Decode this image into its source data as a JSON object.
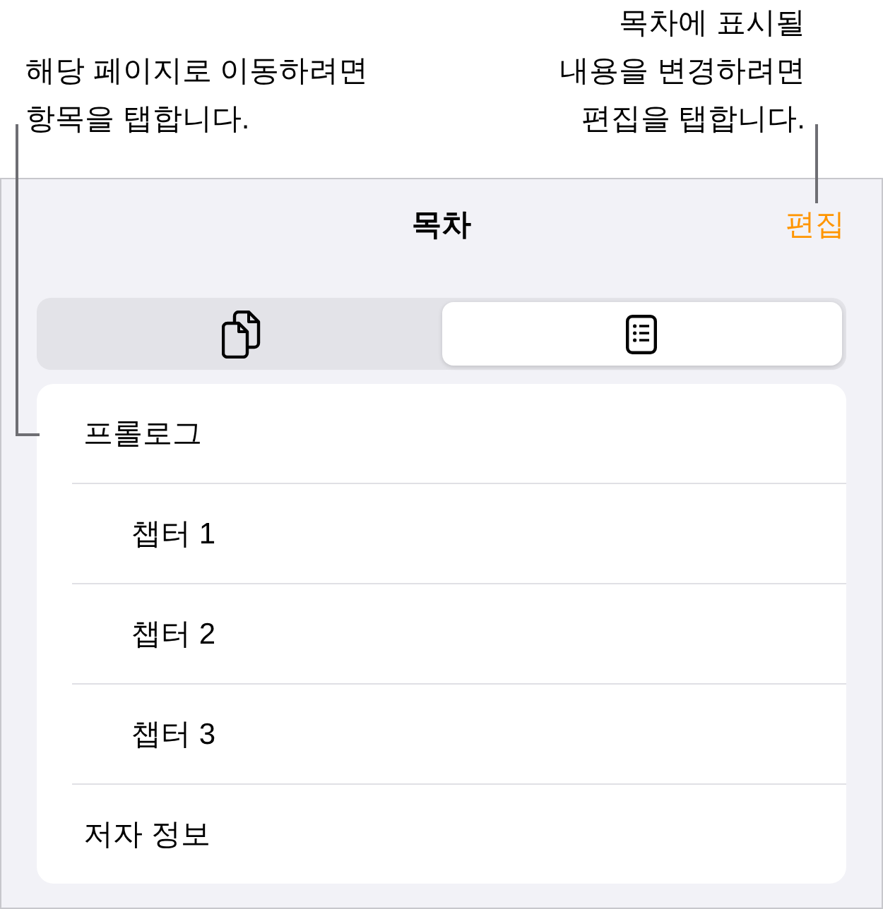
{
  "callouts": [
    {
      "kind": "left",
      "text": "해당 페이지로 이동하려면\n항목을 탭합니다."
    },
    {
      "kind": "right",
      "text": "목차에 표시될\n내용을 변경하려면\n편집을 탭합니다."
    }
  ],
  "panel": {
    "title": "목차",
    "edit_button": "편집",
    "segments": [
      {
        "kind": "pages",
        "selected": false
      },
      {
        "kind": "outline",
        "selected": true
      }
    ],
    "contents": [
      {
        "label": "프롤로그",
        "children": [
          {
            "label": "챕터 1"
          },
          {
            "label": "챕터 2"
          },
          {
            "label": "챕터 3"
          }
        ]
      },
      {
        "label": "저자 정보"
      }
    ]
  }
}
